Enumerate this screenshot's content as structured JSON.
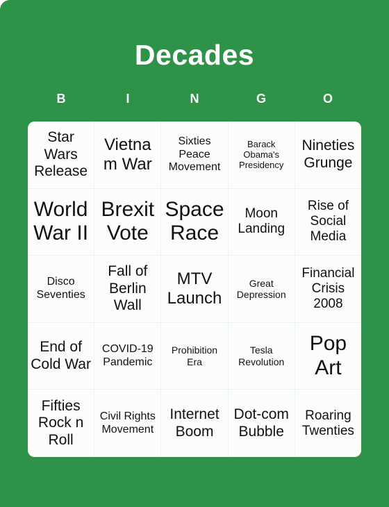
{
  "card": {
    "title": "Decades",
    "background_color": "#2e9248",
    "title_color": "#ffffff",
    "cell_background_color": "#fbfdfb",
    "cell_border_color": "#eef2ee",
    "cell_text_color": "#111111"
  },
  "columns": [
    {
      "letter": "B"
    },
    {
      "letter": "I"
    },
    {
      "letter": "N"
    },
    {
      "letter": "G"
    },
    {
      "letter": "O"
    }
  ],
  "grid": {
    "rows": [
      {
        "cells": [
          {
            "text": "Star Wars Release",
            "size": "fs-l"
          },
          {
            "text": "Vietnam War",
            "size": "fs-xl"
          },
          {
            "text": "Sixties Peace Movement",
            "size": "fs-s"
          },
          {
            "text": "Barack Obama's Presidency",
            "size": "fs-xxs"
          },
          {
            "text": "Nineties Grunge",
            "size": "fs-l"
          }
        ]
      },
      {
        "cells": [
          {
            "text": "World War II",
            "size": "fs-xxl"
          },
          {
            "text": "Brexit Vote",
            "size": "fs-xxl"
          },
          {
            "text": "Space Race",
            "size": "fs-xxl"
          },
          {
            "text": "Moon Landing",
            "size": "fs-m"
          },
          {
            "text": "Rise of Social Media",
            "size": "fs-m"
          }
        ]
      },
      {
        "cells": [
          {
            "text": "Disco Seventies",
            "size": "fs-s"
          },
          {
            "text": "Fall of Berlin Wall",
            "size": "fs-l"
          },
          {
            "text": "MTV Launch",
            "size": "fs-xl"
          },
          {
            "text": "Great Depression",
            "size": "fs-xs"
          },
          {
            "text": "Financial Crisis 2008",
            "size": "fs-m"
          }
        ]
      },
      {
        "cells": [
          {
            "text": "End of Cold War",
            "size": "fs-l"
          },
          {
            "text": "COVID-19 Pandemic",
            "size": "fs-s"
          },
          {
            "text": "Prohibition Era",
            "size": "fs-xs"
          },
          {
            "text": "Tesla Revolution",
            "size": "fs-xs"
          },
          {
            "text": "Pop Art",
            "size": "fs-xxl"
          }
        ]
      },
      {
        "cells": [
          {
            "text": "Fifties Rock n Roll",
            "size": "fs-l"
          },
          {
            "text": "Civil Rights Movement",
            "size": "fs-s"
          },
          {
            "text": "Internet Boom",
            "size": "fs-l"
          },
          {
            "text": "Dot-com Bubble",
            "size": "fs-l"
          },
          {
            "text": "Roaring Twenties",
            "size": "fs-m"
          }
        ]
      }
    ]
  }
}
